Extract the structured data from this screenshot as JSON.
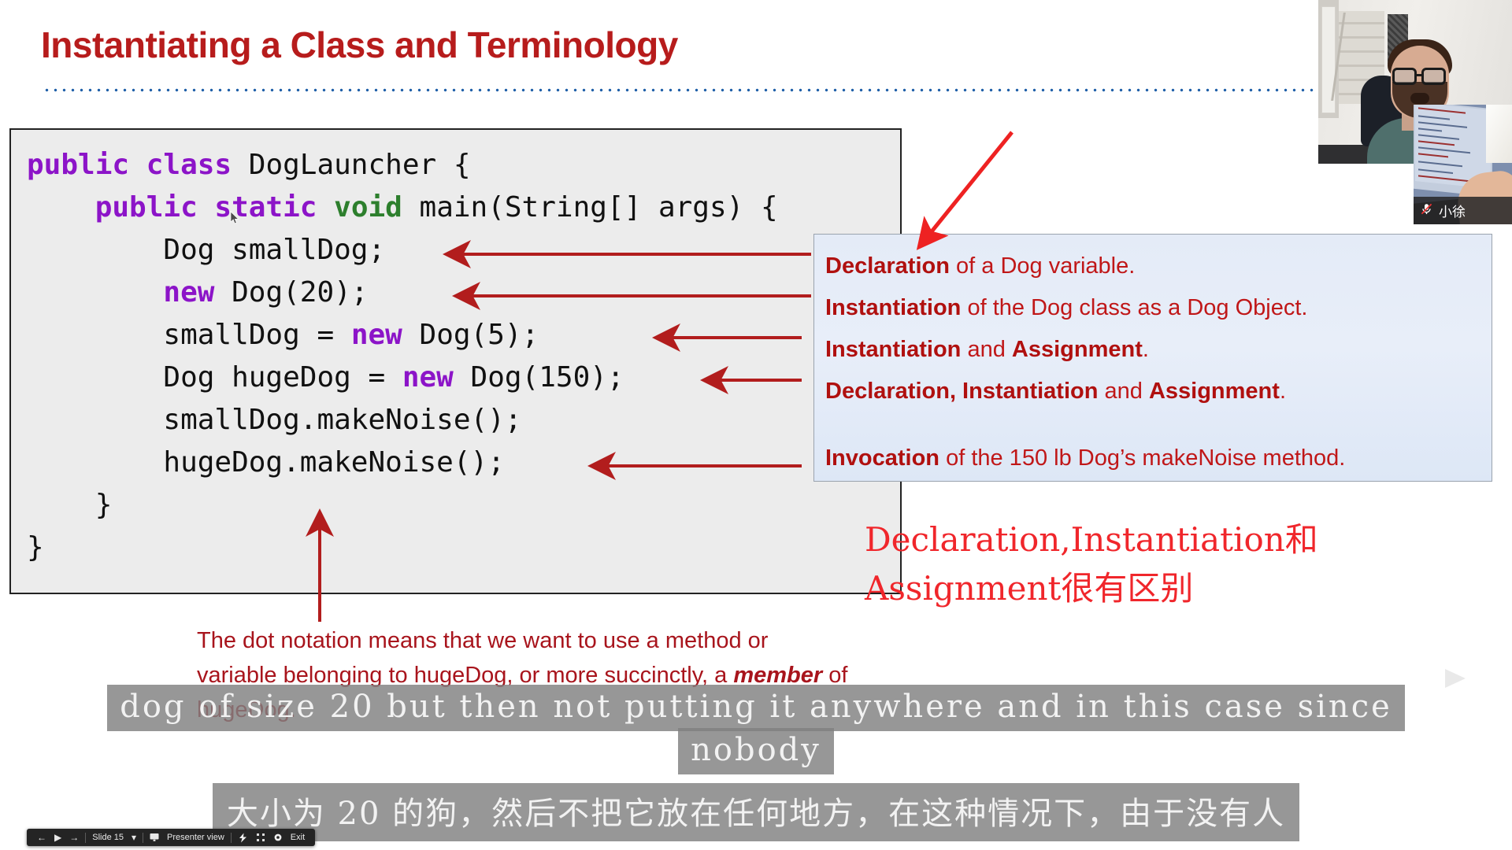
{
  "slide": {
    "title": "Instantiating a Class and Terminology",
    "code_lines": [
      [
        {
          "t": "public class ",
          "c": "kw"
        },
        {
          "t": "DogLauncher {",
          "c": ""
        }
      ],
      [
        {
          "t": "    public static ",
          "c": "kw"
        },
        {
          "t": "void ",
          "c": "kw2"
        },
        {
          "t": "main(String[] args) {",
          "c": ""
        }
      ],
      [
        {
          "t": "        Dog smallDog;",
          "c": ""
        }
      ],
      [
        {
          "t": "        new ",
          "c": "kw"
        },
        {
          "t": "Dog(20);",
          "c": ""
        }
      ],
      [
        {
          "t": "        smallDog = ",
          "c": ""
        },
        {
          "t": "new ",
          "c": "kw"
        },
        {
          "t": "Dog(5);",
          "c": ""
        }
      ],
      [
        {
          "t": "        Dog hugeDog = ",
          "c": ""
        },
        {
          "t": "new ",
          "c": "kw"
        },
        {
          "t": "Dog(150);",
          "c": ""
        }
      ],
      [
        {
          "t": "        smallDog.makeNoise();",
          "c": ""
        }
      ],
      [
        {
          "t": "        hugeDog.makeNoise();",
          "c": ""
        }
      ],
      [
        {
          "t": "    }",
          "c": ""
        }
      ],
      [
        {
          "t": "}",
          "c": ""
        }
      ]
    ],
    "callout": {
      "lines": [
        {
          "bold": "Declaration",
          "rest": " of a Dog variable."
        },
        {
          "bold": "Instantiation",
          "rest": " of the Dog class as a Dog Object."
        },
        {
          "bold": "Instantiation",
          "rest": " and ",
          "bold2": "Assignment",
          "rest2": "."
        },
        {
          "bold": "Declaration, Instantiation",
          "rest": " and ",
          "bold2": "Assignment",
          "rest2": "."
        },
        {
          "bold": "Invocation",
          "rest": " of the 150 lb Dog’s makeNoise method."
        }
      ]
    },
    "dot_note": {
      "part1": "The dot notation means that we want to use a method or variable belonging to hugeDog, or more succinctly, a ",
      "emphasis": "member",
      "part2": " of hugeDog."
    },
    "cn_annotation_line1": "Declaration,Instantiation和",
    "cn_annotation_line2": "Assignment很有区别"
  },
  "subtitles": {
    "english_line1": "dog of size 20 but then not putting it anywhere and in this case since",
    "english_line2": "nobody",
    "chinese": "大小为 20 的狗，然后不把它放在任何地方，在这种情况下，由于没有人"
  },
  "webcam": {
    "participant_name": "小徐",
    "mute_icon": "microphone-muted-icon"
  },
  "toolbar": {
    "prev_icon": "←",
    "play_icon": "▶",
    "next_icon": "→",
    "slide_label": "Slide 15",
    "dropdown_icon": "▾",
    "presenter_view_label": "Presenter view",
    "presenter_icon": "monitor-icon",
    "laser_icon": "laser-pointer-icon",
    "grid_icon": "grid-view-icon",
    "settings_icon": "gear-icon",
    "exit_label": "Exit"
  },
  "colors": {
    "title_red": "#b71c1c",
    "callout_red": "#c01718",
    "arrow_red": "#b21d1d",
    "keyword_purple": "#8c14c8",
    "keyword_green": "#2d7f2d",
    "rule_blue": "#1f5fa8",
    "cn_red": "#f0262b"
  }
}
